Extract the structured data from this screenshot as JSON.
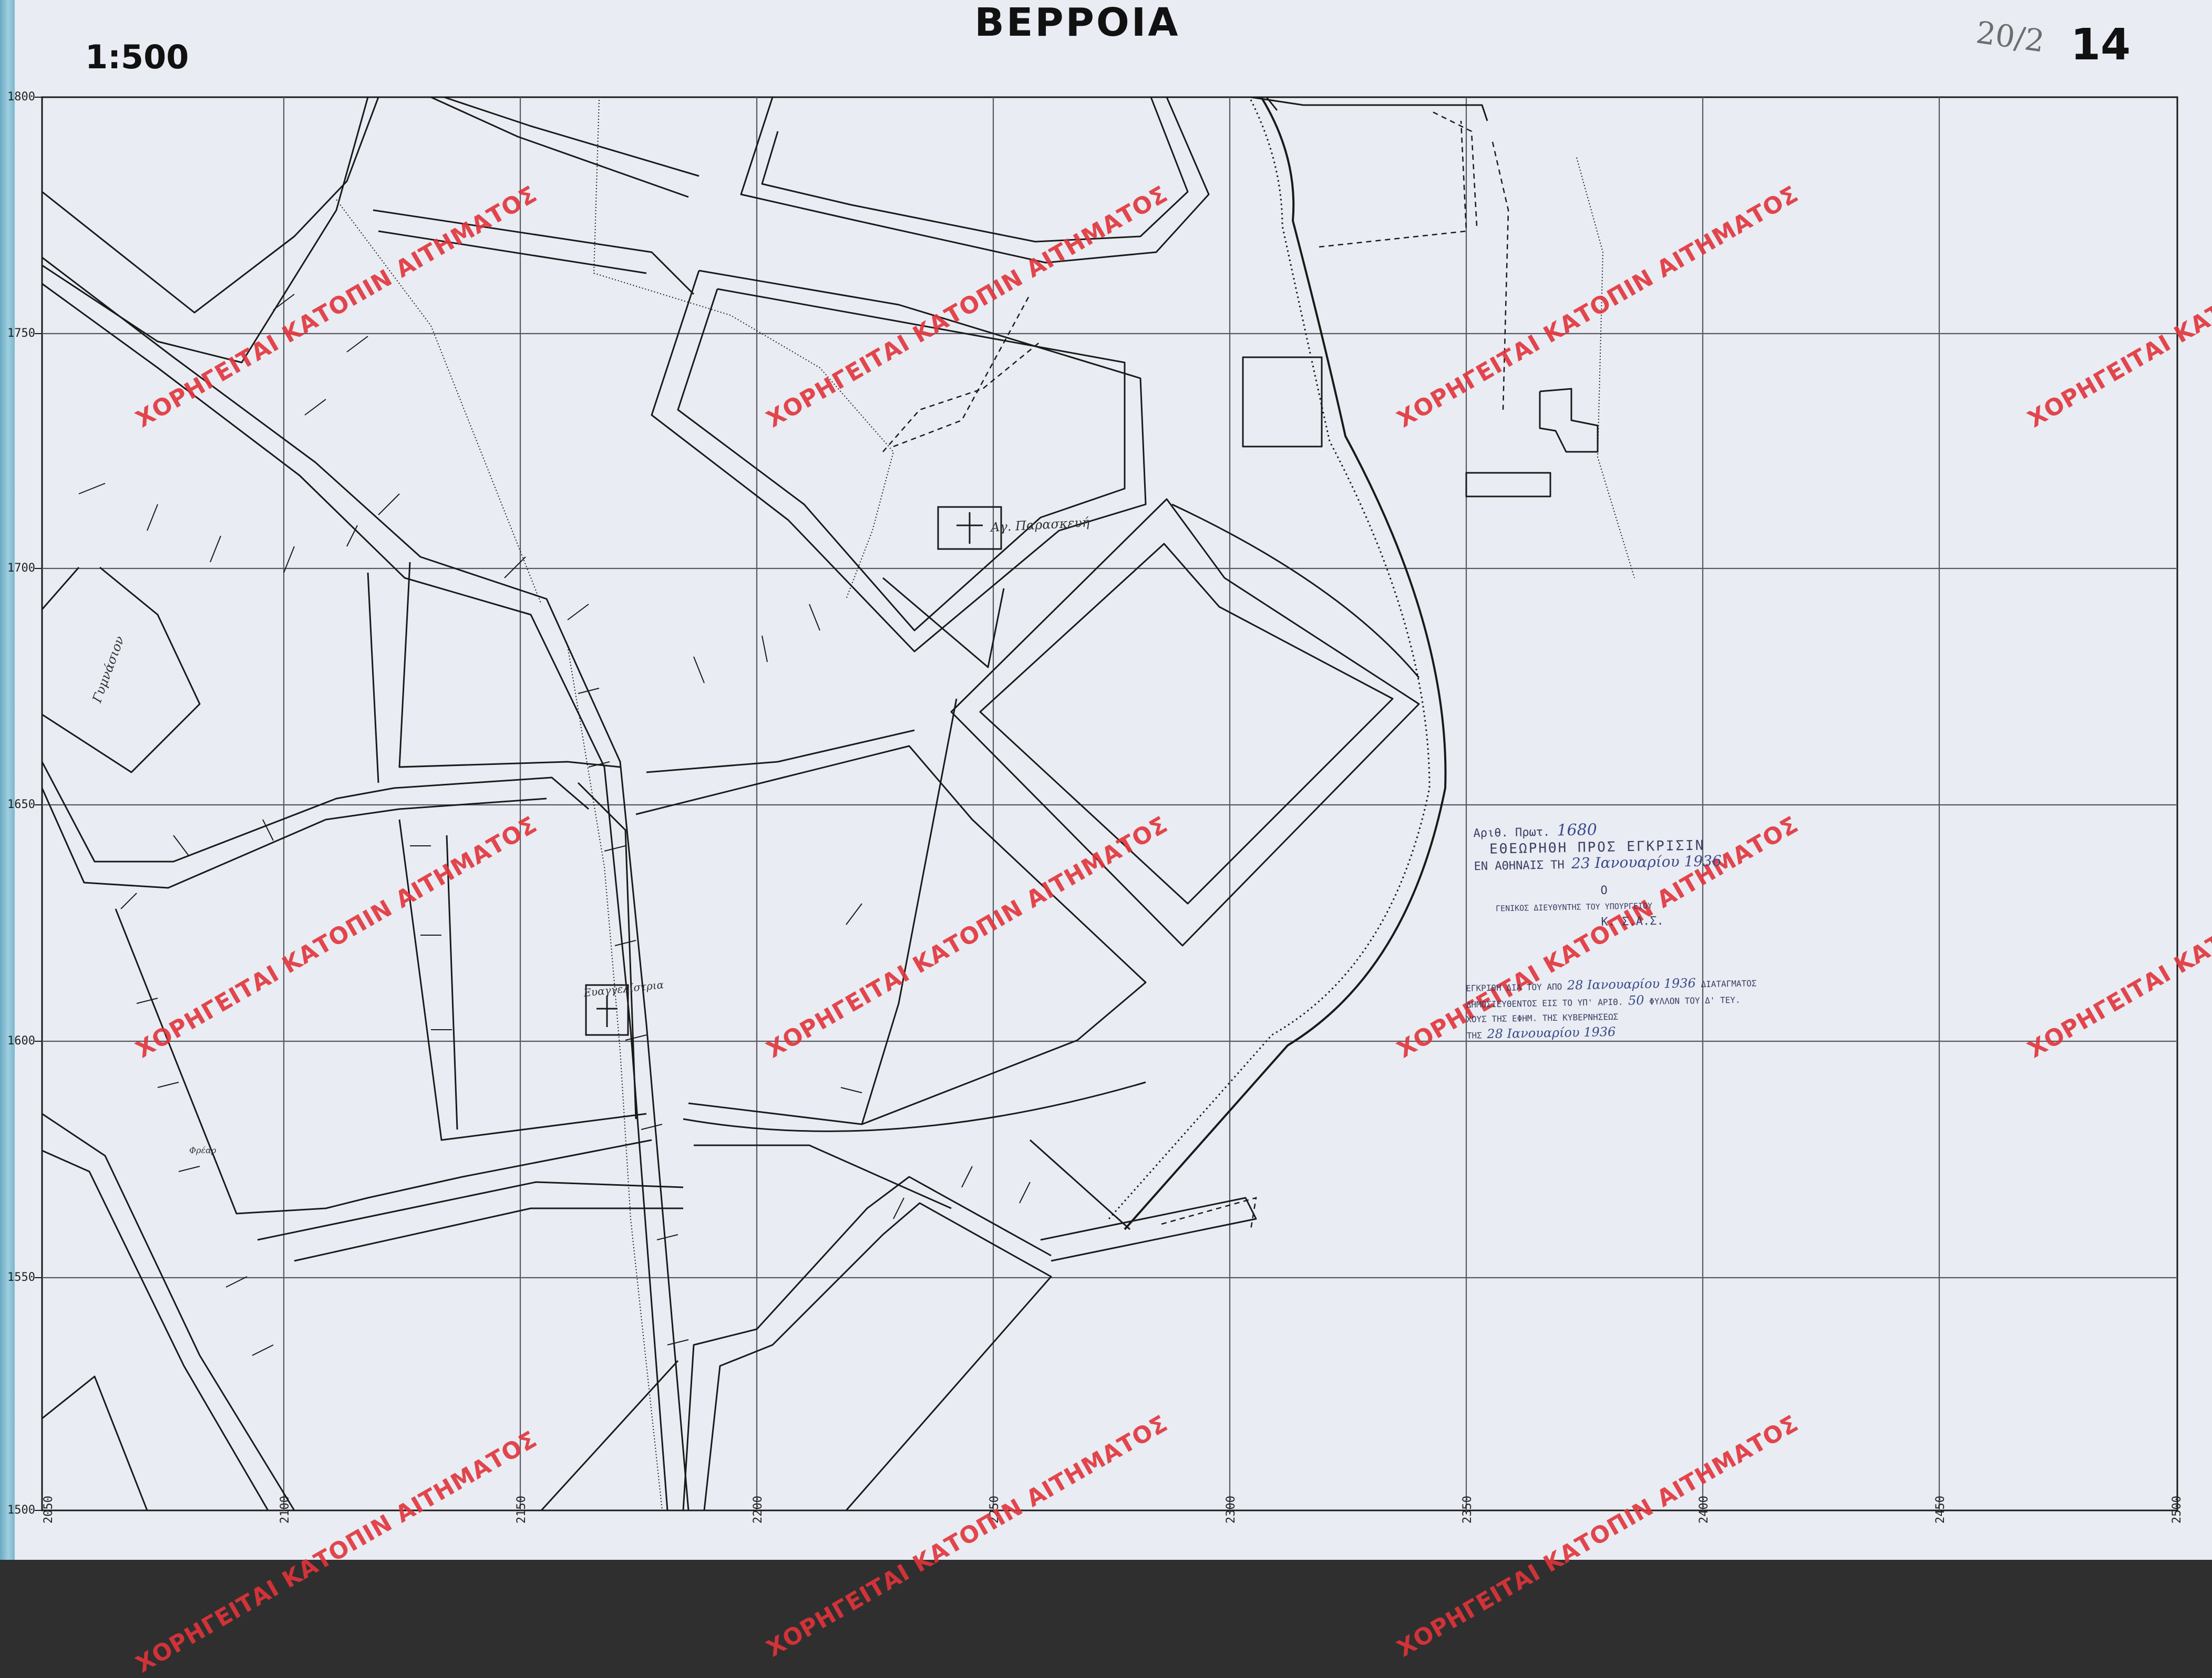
{
  "map": {
    "title": "ΒΕΡΡΟΙΑ",
    "scale": "1:500",
    "sheet_number": "14",
    "pencil_note": "20/2",
    "y_ticks": [
      "1800",
      "1750",
      "1700",
      "1650",
      "1600",
      "1550",
      "1500"
    ],
    "x_ticks": [
      "2050",
      "2100",
      "2150",
      "2200",
      "2250",
      "2300",
      "2350",
      "2400",
      "2450",
      "2500"
    ],
    "labels": {
      "church_1": "Αγ. Παρασκευή",
      "church_2": "Ευαγγελίστρια",
      "building": "Γυμνάσιον",
      "small": "Φρέαρ"
    },
    "watermark": "ΧΟΡΗΓΕΙΤΑΙ ΚΑΤΟΠΙΝ ΑΙΤΗΜΑΤΟΣ",
    "stamp": {
      "line1_prefix": "Αριθ. Πρωτ.",
      "line1_value": "1680",
      "line2": "ΕΘΕΩΡΗΘΗ ΠΡΟΣ ΕΓΚΡΙΣΙΝ",
      "line3_prefix": "ΕΝ ΑΘΗΝΑΙΣ ΤΗ",
      "line3_value": "23 Ιανουαρίου 1936",
      "line4": "Ο",
      "line5": "ΓΕΝΙΚΟΣ ΔΙΕΥΘΥΝΤΗΣ ΤΟΥ ΥΠΟΥΡΓΕΙΟΥ",
      "line6": "Κ. Σ.Α.Σ.",
      "approval1_prefix": "ΕΓΚΡΙΘΗ ΔΙΑ ΤΟΥ ΑΠΟ",
      "approval1_value": "28 Ιανουαρίου 1936",
      "approval1_suffix": "ΔΙΑΤΑΓΜΑΤΟΣ",
      "approval2_prefix": "ΔΗΜΟΣΙΕΥΘΕΝΤΟΣ ΕΙΣ ΤΟ ΥΠ' ΑΡΙΘ.",
      "approval2_value": "50",
      "approval2_suffix": "ΦΥΛΛΟΝ ΤΟΥ Δ' ΤΕΥ.",
      "approval3": "ΧΟΥΣ ΤΗΣ ΕΦΗΜ. ΤΗΣ ΚΥΒΕΡΝΗΣΕΩΣ",
      "approval4_prefix": "ΤΗΣ",
      "approval4_value": "28 Ιανουαρίου 1936"
    },
    "colors": {
      "paper": "#e9ecf3",
      "ink": "#1a1a1a",
      "grid": "#55585f",
      "watermark": "#e2343a",
      "stamp_ink": "#3a3f62",
      "tape": "#7ab7cc"
    }
  }
}
